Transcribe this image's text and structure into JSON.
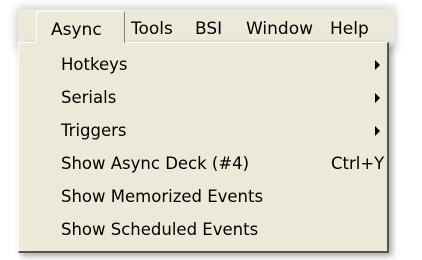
{
  "menubar": {
    "items": [
      {
        "label": "Async",
        "active": true
      },
      {
        "label": "Tools"
      },
      {
        "label": "BSI"
      },
      {
        "label": "Window"
      },
      {
        "label": "Help"
      }
    ]
  },
  "dropdown": {
    "items": [
      {
        "label": "Hotkeys",
        "submenu": true
      },
      {
        "label": "Serials",
        "submenu": true
      },
      {
        "label": "Triggers",
        "submenu": true
      },
      {
        "label": "Show Async Deck (#4)",
        "shortcut": "Ctrl+Y"
      },
      {
        "label": "Show Memorized Events"
      },
      {
        "label": "Show Scheduled Events"
      }
    ]
  },
  "colors": {
    "menu_background": "#ece9d8",
    "text": "#000000"
  }
}
